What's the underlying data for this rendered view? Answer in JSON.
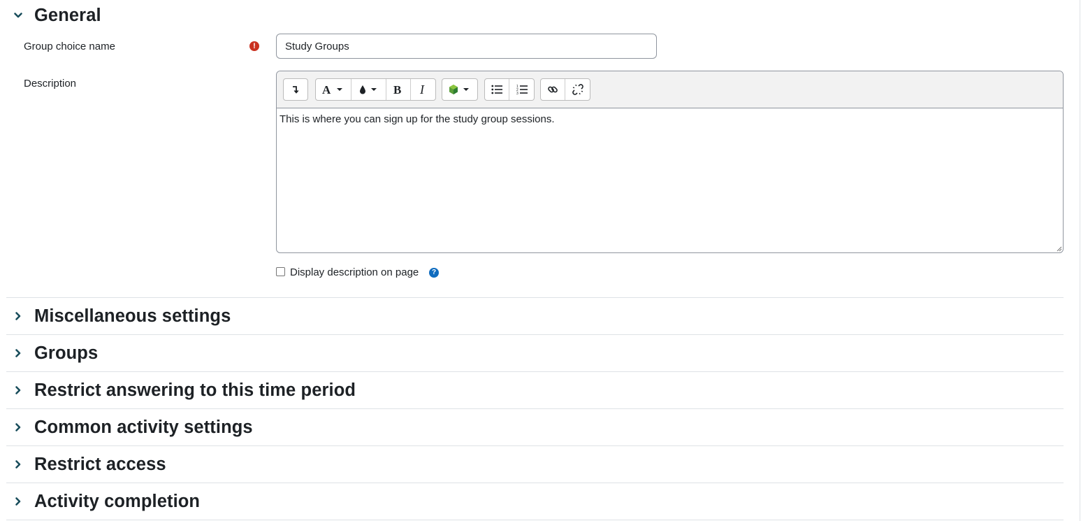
{
  "sections": [
    {
      "id": "general",
      "title": "General",
      "expanded": true
    },
    {
      "id": "misc",
      "title": "Miscellaneous settings",
      "expanded": false
    },
    {
      "id": "groups",
      "title": "Groups",
      "expanded": false
    },
    {
      "id": "restrict-time",
      "title": "Restrict answering to this time period",
      "expanded": false
    },
    {
      "id": "common",
      "title": "Common activity settings",
      "expanded": false
    },
    {
      "id": "restrict-access",
      "title": "Restrict access",
      "expanded": false
    },
    {
      "id": "completion",
      "title": "Activity completion",
      "expanded": false
    }
  ],
  "general": {
    "name_label": "Group choice name",
    "name_value": "Study Groups",
    "required_icon": "exclamation-circle-icon",
    "description_label": "Description",
    "description_text": "This is where you can sign up for the study group sessions.",
    "display_description_label": "Display description on page",
    "display_description_checked": false,
    "help_icon": "question-circle-icon"
  },
  "editor_toolbar": [
    {
      "group": "collapse",
      "buttons": [
        "collapse-icon"
      ]
    },
    {
      "group": "style",
      "buttons": [
        "font-style-dropdown-icon",
        "color-dropdown-icon",
        "bold-icon",
        "italic-icon"
      ]
    },
    {
      "group": "files",
      "buttons": [
        "media-dropdown-icon"
      ]
    },
    {
      "group": "list",
      "buttons": [
        "unordered-list-icon",
        "ordered-list-icon"
      ]
    },
    {
      "group": "links",
      "buttons": [
        "link-icon",
        "unlink-icon"
      ]
    }
  ],
  "colors": {
    "accent": "#0f6cbf",
    "chevron": "#1a4e5c",
    "required": "#ca3120",
    "border": "#8f959e",
    "separator": "#dee2e6"
  }
}
